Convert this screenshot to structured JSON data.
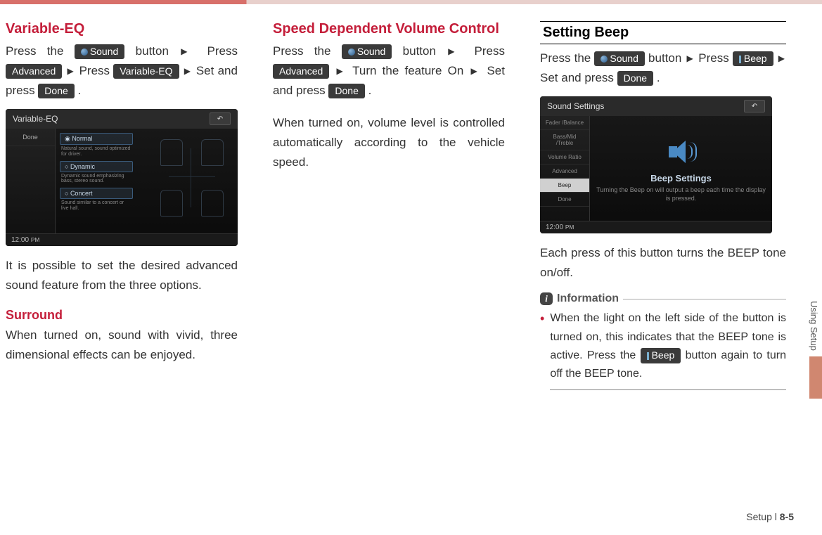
{
  "col1": {
    "h1": "Variable-EQ",
    "p1_a": "Press the ",
    "p1_b": " button ",
    "p1_c": " Press ",
    "p1_d": " Press ",
    "p1_e": " Set and press ",
    "btn_sound": "Sound",
    "btn_adv": "Advanced",
    "btn_veq": "Variable-EQ",
    "btn_done": "Done",
    "screenshot": {
      "title": "Variable-EQ",
      "done": "Done",
      "opt1": "Normal",
      "opt1d": "Natural sound, sound optimized for driver.",
      "opt2": "Dynamic",
      "opt2d": "Dynamic sound emphasizing bass, stereo sound.",
      "opt3": "Concert",
      "opt3d": "Sound similar to a concert or live hall.",
      "clock": "12:00",
      "ampm": "PM"
    },
    "p2": "It is possible to set the desired advanced sound feature from the three options.",
    "h2": "Surround",
    "p3": "When turned on, sound with vivid, three dimensional effects can be enjoyed."
  },
  "col2": {
    "h1": "Speed Dependent Volume Control",
    "p1_a": "Press the ",
    "p1_b": " button ",
    "p1_c": " Press ",
    "p1_d": " Turn the feature On ",
    "p1_e": " Set and press ",
    "btn_sound": "Sound",
    "btn_adv": "Advanced",
    "btn_done": "Done",
    "p2": "When turned on, volume level is controlled automatically according to the vehicle speed."
  },
  "col3": {
    "h1": "Setting Beep",
    "p1_a": "Press the ",
    "p1_b": " button ",
    "p1_c": " Press ",
    "p1_d": " Set and press ",
    "btn_sound": "Sound",
    "btn_beep": "Beep",
    "btn_done": "Done",
    "screenshot": {
      "title": "Sound Settings",
      "side": [
        "Fader /Balance",
        "Bass/Mid /Treble",
        "Volume Ratio",
        "Advanced",
        "Beep",
        "Done"
      ],
      "main_title": "Beep Settings",
      "main_desc": "Turning the Beep on will output a beep each time the display is pressed.",
      "clock": "12:00",
      "ampm": "PM"
    },
    "p2": "Each press of this button turns the BEEP tone on/off.",
    "info_label": "Information",
    "bullet_a": "When the light on the left side of the button is turned on, this indicates that the BEEP tone is active. Press the ",
    "bullet_b": " button again to turn off the BEEP tone.",
    "btn_beep2": "Beep"
  },
  "side_tab": "Using Setup",
  "footer_a": "Setup  l  ",
  "footer_b": "8-5",
  "arrow": "▶",
  "radio": "◉",
  "period": " ."
}
